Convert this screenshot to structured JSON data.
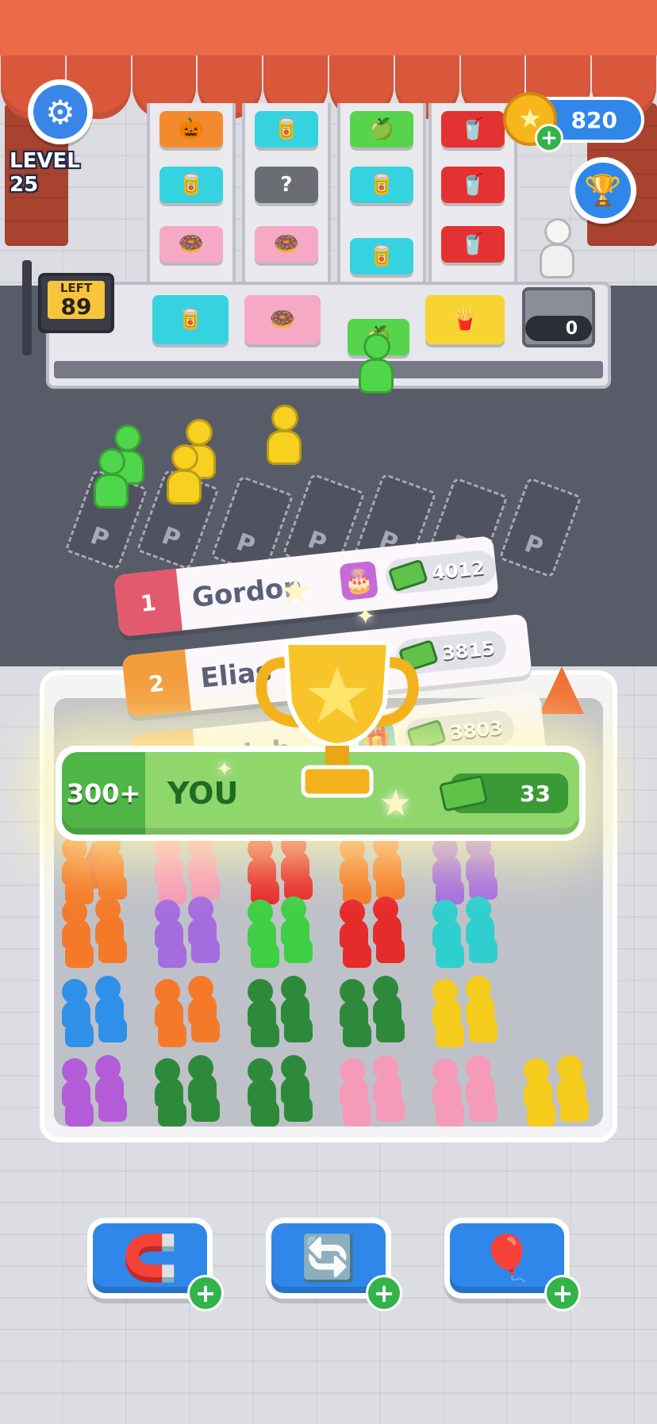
{
  "hud": {
    "level_label": "LEVEL 25",
    "coins": "820",
    "plus": "+",
    "settings_icon": "gear-icon",
    "trophy_icon": "trophy-icon"
  },
  "queue_sign": {
    "label": "LEFT",
    "count": "89"
  },
  "register": {
    "value": "0"
  },
  "shelves": [
    {
      "items": [
        "pumpkin",
        "drink-can",
        "donut"
      ],
      "colors": [
        "#f38b2e",
        "#35d3df",
        "#f6a9c4"
      ]
    },
    {
      "items": [
        "drink-can",
        "mystery",
        "donut"
      ],
      "colors": [
        "#35d3df",
        "#6b6d75",
        "#f6a9c4"
      ]
    },
    {
      "items": [
        "apple",
        "drink-can",
        "drink-can"
      ],
      "colors": [
        "#55d44c",
        "#35d3df",
        "#35d3df"
      ]
    },
    {
      "items": [
        "cup",
        "cup",
        "cup"
      ],
      "colors": [
        "#e43232",
        "#e43232",
        "#e43232"
      ]
    }
  ],
  "counter_items": [
    "drink-can",
    "donut",
    "apple",
    "fries"
  ],
  "parking_label": "P",
  "leaderboard": {
    "rows": [
      {
        "rank": "1",
        "name": "Gordon",
        "score": "4012",
        "gift": "cake",
        "rank_color": "#e25a6e"
      },
      {
        "rank": "2",
        "name": "Elias",
        "score": "3815",
        "gift": "gift-box",
        "rank_color": "#f39c3c"
      },
      {
        "rank": "3",
        "name": "Leigh",
        "score": "3803",
        "gift": "gift-box",
        "rank_color": "#f5b66a"
      }
    ],
    "you": {
      "rank": "300+",
      "name": "YOU",
      "score": "33"
    }
  },
  "powerups": [
    {
      "name": "magnet",
      "icon": "magnet-icon"
    },
    {
      "name": "shuffle",
      "icon": "shuffle-icon"
    },
    {
      "name": "balloon",
      "icon": "balloon-icon"
    }
  ],
  "colors": {
    "accent_blue": "#2f87ea",
    "awning": "#ec6a48",
    "green": "#4fb547",
    "gold": "#f6b61c"
  }
}
